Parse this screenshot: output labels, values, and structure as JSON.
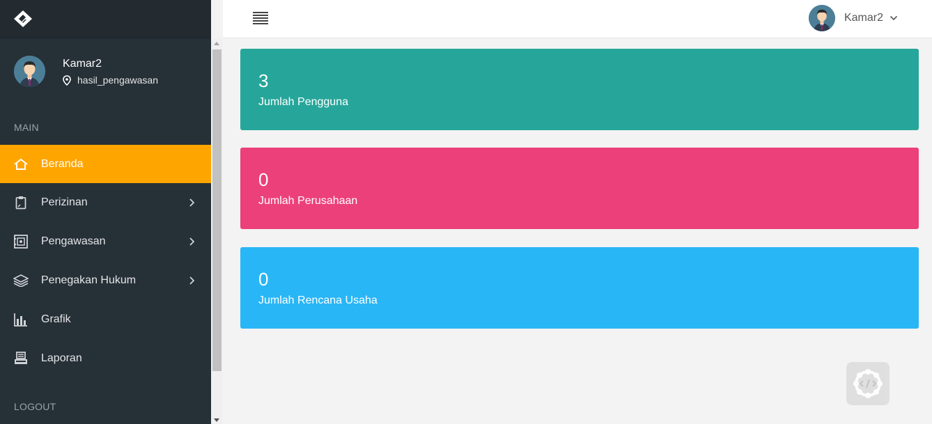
{
  "sidebar": {
    "user": {
      "name": "Kamar2",
      "location": "hasil_pengawasan"
    },
    "section_main": "MAIN",
    "section_logout": "LOGOUT",
    "items": [
      {
        "label": "Beranda",
        "icon": "home-icon",
        "active": true,
        "has_submenu": false
      },
      {
        "label": "Perizinan",
        "icon": "clipboard-icon",
        "active": false,
        "has_submenu": true
      },
      {
        "label": "Pengawasan",
        "icon": "safe-icon",
        "active": false,
        "has_submenu": true
      },
      {
        "label": "Penegakan Hukum",
        "icon": "layers-icon",
        "active": false,
        "has_submenu": true
      },
      {
        "label": "Grafik",
        "icon": "bar-chart-icon",
        "active": false,
        "has_submenu": false
      },
      {
        "label": "Laporan",
        "icon": "printer-icon",
        "active": false,
        "has_submenu": false
      }
    ]
  },
  "header": {
    "user_name": "Kamar2",
    "menu_icon": "hamburger-icon"
  },
  "cards": [
    {
      "value": "3",
      "label": "Jumlah Pengguna",
      "color": "#26a69a"
    },
    {
      "value": "0",
      "label": "Jumlah Perusahaan",
      "color": "#ec407a"
    },
    {
      "value": "0",
      "label": "Jumlah Rencana Usaha",
      "color": "#29b6f6"
    }
  ],
  "colors": {
    "sidebar_bg": "#263037",
    "active_item": "#ffa500",
    "content_bg": "#f3f3f3"
  }
}
